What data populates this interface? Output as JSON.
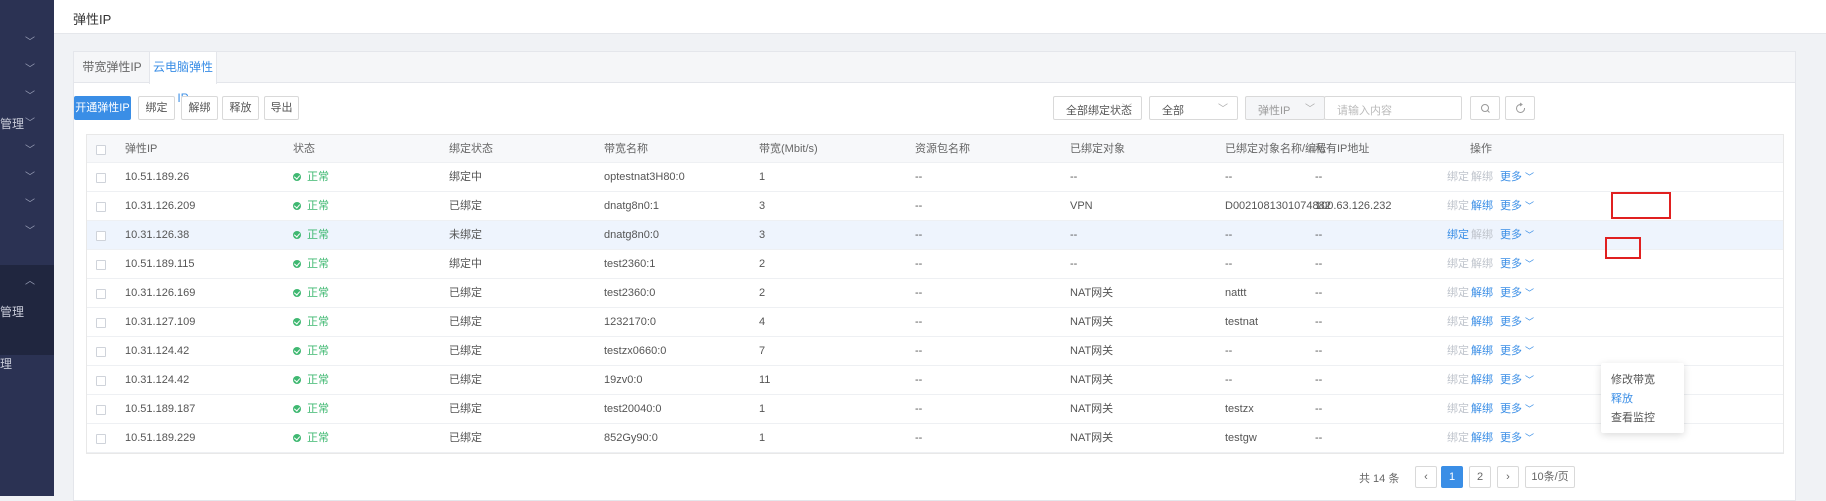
{
  "sidebar": {
    "items": [
      {
        "label": ""
      },
      {
        "label": ""
      },
      {
        "label": ""
      },
      {
        "label": "管理"
      },
      {
        "label": ""
      },
      {
        "label": ""
      },
      {
        "label": ""
      },
      {
        "label": ""
      },
      {
        "label": ""
      },
      {
        "label": "管理"
      },
      {
        "label": "理"
      }
    ]
  },
  "page": {
    "title": "弹性IP"
  },
  "tabs": [
    {
      "label": "带宽弹性IP"
    },
    {
      "label": "云电脑弹性IP"
    }
  ],
  "toolbar": {
    "create": "开通弹性IP",
    "bind": "绑定",
    "unbind": "解绑",
    "release": "释放",
    "export": "导出",
    "status_filter": "全部绑定状态",
    "type_filter": "全部",
    "field_select": "弹性IP",
    "search_placeholder": "请输入内容"
  },
  "table": {
    "headers": [
      "弹性IP",
      "状态",
      "绑定状态",
      "带宽名称",
      "带宽(Mbit/s)",
      "资源包名称",
      "已绑定对象",
      "已绑定对象名称/编号",
      "私有IP地址",
      "操作"
    ],
    "rows": [
      {
        "ip": "10.51.189.26",
        "status": "正常",
        "bind_status": "绑定中",
        "bw_name": "optestnat3H80:0",
        "bw": "1",
        "pkg": "--",
        "obj": "--",
        "obj_name": "--",
        "private_ip": "--"
      },
      {
        "ip": "10.31.126.209",
        "status": "正常",
        "bind_status": "已绑定",
        "bw_name": "dnatg8n0:1",
        "bw": "3",
        "pkg": "--",
        "obj": "VPN",
        "obj_name": "D0021081301074882",
        "private_ip": "100.63.126.232"
      },
      {
        "ip": "10.31.126.38",
        "status": "正常",
        "bind_status": "未绑定",
        "bw_name": "dnatg8n0:0",
        "bw": "3",
        "pkg": "--",
        "obj": "--",
        "obj_name": "--",
        "private_ip": "--"
      },
      {
        "ip": "10.51.189.115",
        "status": "正常",
        "bind_status": "绑定中",
        "bw_name": "test2360:1",
        "bw": "2",
        "pkg": "--",
        "obj": "--",
        "obj_name": "--",
        "private_ip": "--"
      },
      {
        "ip": "10.31.126.169",
        "status": "正常",
        "bind_status": "已绑定",
        "bw_name": "test2360:0",
        "bw": "2",
        "pkg": "--",
        "obj": "NAT网关",
        "obj_name": "nattt",
        "private_ip": "--"
      },
      {
        "ip": "10.31.127.109",
        "status": "正常",
        "bind_status": "已绑定",
        "bw_name": "1232170:0",
        "bw": "4",
        "pkg": "--",
        "obj": "NAT网关",
        "obj_name": "testnat",
        "private_ip": "--"
      },
      {
        "ip": "10.31.124.42",
        "status": "正常",
        "bind_status": "已绑定",
        "bw_name": "testzx0660:0",
        "bw": "7",
        "pkg": "--",
        "obj": "NAT网关",
        "obj_name": "--",
        "private_ip": "--"
      },
      {
        "ip": "10.31.124.42",
        "status": "正常",
        "bind_status": "已绑定",
        "bw_name": "19zv0:0",
        "bw": "11",
        "pkg": "--",
        "obj": "NAT网关",
        "obj_name": "--",
        "private_ip": "--"
      },
      {
        "ip": "10.51.189.187",
        "status": "正常",
        "bind_status": "已绑定",
        "bw_name": "test20040:0",
        "bw": "1",
        "pkg": "--",
        "obj": "NAT网关",
        "obj_name": "testzx",
        "private_ip": "--"
      },
      {
        "ip": "10.51.189.229",
        "status": "正常",
        "bind_status": "已绑定",
        "bw_name": "852Gy90:0",
        "bw": "1",
        "pkg": "--",
        "obj": "NAT网关",
        "obj_name": "testgw",
        "private_ip": "--"
      }
    ],
    "actions": {
      "bind": "绑定",
      "unbind": "解绑",
      "more": "更多"
    },
    "row_actions": [
      {
        "bind_enabled": false,
        "unbind_enabled": false
      },
      {
        "bind_enabled": false,
        "unbind_enabled": true
      },
      {
        "bind_enabled": true,
        "unbind_enabled": false
      },
      {
        "bind_enabled": false,
        "unbind_enabled": false
      },
      {
        "bind_enabled": false,
        "unbind_enabled": true
      },
      {
        "bind_enabled": false,
        "unbind_enabled": true
      },
      {
        "bind_enabled": false,
        "unbind_enabled": true
      },
      {
        "bind_enabled": false,
        "unbind_enabled": true
      },
      {
        "bind_enabled": false,
        "unbind_enabled": true
      },
      {
        "bind_enabled": false,
        "unbind_enabled": true
      }
    ]
  },
  "more_menu": {
    "items": [
      "修改带宽",
      "释放",
      "查看监控"
    ]
  },
  "pagination": {
    "total": "共 14 条",
    "pages": [
      "1",
      "2"
    ],
    "current": "1",
    "page_size": "10条/页"
  },
  "colors": {
    "accent": "#3a8ee6",
    "ok": "#3fb871",
    "highlight": "#e02020",
    "sidebar": "#2b3253"
  }
}
